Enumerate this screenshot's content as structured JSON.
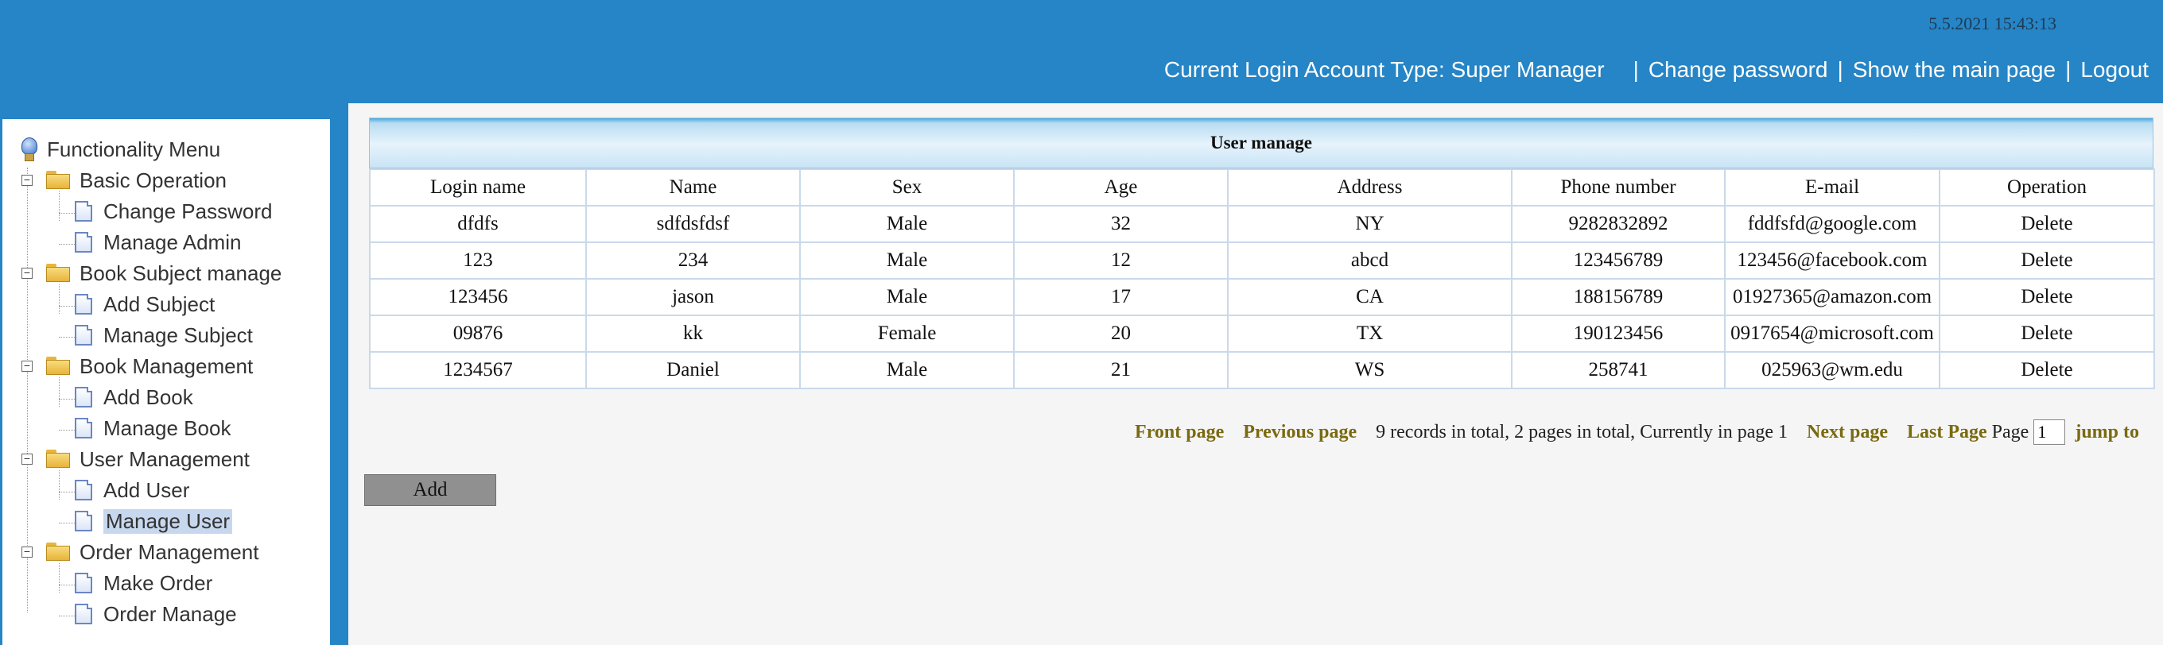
{
  "header": {
    "datetime": "5.5.2021 15:43:13",
    "account_type": "Current Login Account Type: Super Manager",
    "links": [
      "Change password",
      "Show the main page",
      "Logout"
    ]
  },
  "sidebar": {
    "title": "Functionality Menu",
    "groups": [
      {
        "label": "Basic Operation",
        "items": [
          "Change Password",
          "Manage Admin"
        ]
      },
      {
        "label": "Book Subject manage",
        "items": [
          "Add Subject",
          "Manage Subject"
        ]
      },
      {
        "label": "Book Management",
        "items": [
          "Add Book",
          "Manage Book"
        ]
      },
      {
        "label": "User Management",
        "items": [
          "Add User",
          "Manage User"
        ]
      },
      {
        "label": "Order Management",
        "items": [
          "Make Order",
          "Order Manage"
        ]
      }
    ],
    "selected_item": "Manage User"
  },
  "table": {
    "title": "User manage",
    "columns": [
      "Login name",
      "Name",
      "Sex",
      "Age",
      "Address",
      "Phone number",
      "E-mail",
      "Operation"
    ],
    "rows": [
      [
        "dfdfs",
        "sdfdsfdsf",
        "Male",
        "32",
        "NY",
        "9282832892",
        "fddfsfd@google.com",
        "Delete"
      ],
      [
        "123",
        "234",
        "Male",
        "12",
        "abcd",
        "123456789",
        "123456@facebook.com",
        "Delete"
      ],
      [
        "123456",
        "jason",
        "Male",
        "17",
        "CA",
        "188156789",
        "01927365@amazon.com",
        "Delete"
      ],
      [
        "09876",
        "kk",
        "Female",
        "20",
        "TX",
        "190123456",
        "0917654@microsoft.com",
        "Delete"
      ],
      [
        "1234567",
        "Daniel",
        "Male",
        "21",
        "WS",
        "258741",
        "025963@wm.edu",
        "Delete"
      ]
    ]
  },
  "pager": {
    "front": "Front page",
    "previous": "Previous page",
    "info": "9 records in total, 2 pages in total, Currently in page 1",
    "next": "Next page",
    "last": "Last Page",
    "page_label": "Page",
    "page_value": "1",
    "jump": "jump to"
  },
  "actions": {
    "add_label": "Add"
  },
  "colors": {
    "header_bg": "#2585c6",
    "content_bg": "#f5f5f5",
    "link_gold": "#7a6a10"
  }
}
